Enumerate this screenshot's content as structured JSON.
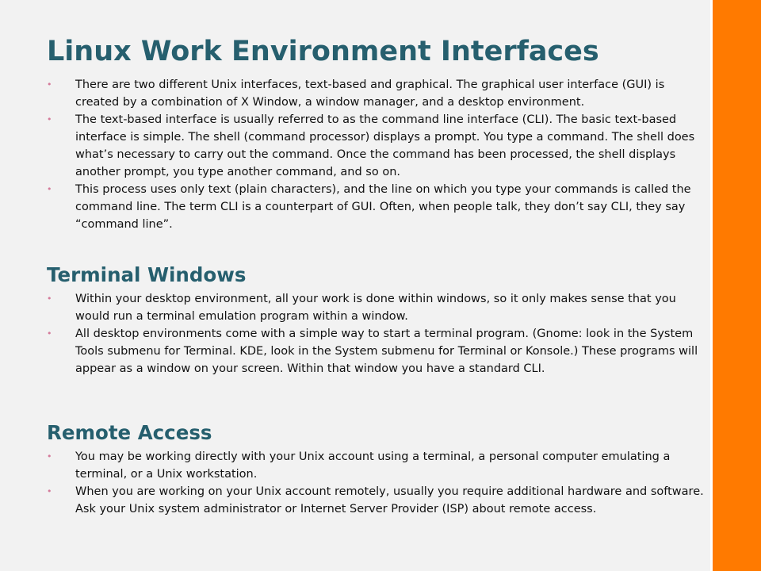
{
  "colors": {
    "heading": "#265f6e",
    "bullet_marker": "#d47a9a",
    "side_bar": "#ff7a00",
    "background": "#f2f2f2"
  },
  "title": "Linux Work Environment Interfaces",
  "bullet_symbol": "•",
  "intro": {
    "bullets": [
      "There are two different Unix interfaces, text-based and graphical. The graphical user interface (GUI) is created by a combination of X Window, a window manager, and a desktop environment.",
      "The text-based interface is usually referred to as the command line interface (CLI). The basic text-based interface is simple. The shell (command processor) displays a prompt. You type a command. The shell does what’s necessary to carry out the command. Once the command has been processed, the shell displays another prompt, you type another command, and so on.",
      "This process uses only text (plain characters), and the line on which you type your commands is called the command line. The term CLI is a counterpart of GUI. Often, when people talk, they don’t say CLI, they say “command line”."
    ]
  },
  "terminal_windows": {
    "heading": "Terminal Windows",
    "bullets": [
      "Within your desktop environment, all your work is done within windows, so it only makes sense that you would run a terminal emulation program within a window.",
      "All desktop environments come with a simple way to start a terminal program.   (Gnome: look in the System Tools submenu for Terminal. KDE, look in the System submenu for Terminal or Konsole.) These programs will appear as a  window on your screen. Within that window you have a standard CLI."
    ]
  },
  "remote_access": {
    "heading": "Remote Access",
    "bullets": [
      "You may be working directly with your Unix account using a terminal, a personal computer emulating a terminal, or a Unix workstation.",
      "When you are working on your Unix account remotely, usually you require additional hardware and software. Ask your Unix system administrator or Internet Server Provider (ISP) about remote access."
    ]
  }
}
